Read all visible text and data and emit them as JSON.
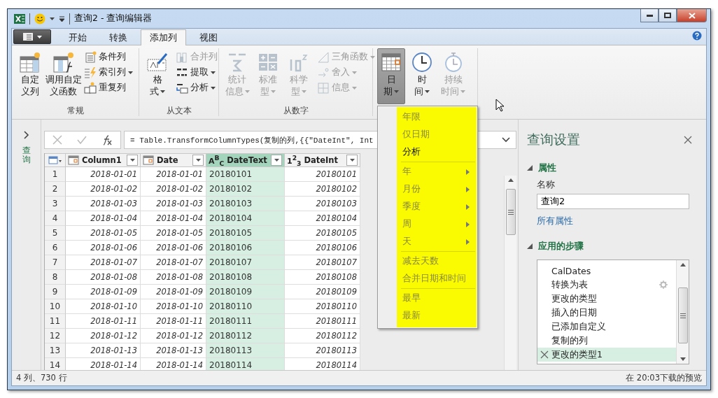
{
  "window": {
    "title": "查询2 - 查询编辑器"
  },
  "ribbon_tabs": [
    {
      "label": "开始",
      "selected": false
    },
    {
      "label": "转换",
      "selected": false
    },
    {
      "label": "添加列",
      "selected": true
    },
    {
      "label": "视图",
      "selected": false
    }
  ],
  "ribbon_groups": [
    {
      "label": "常规",
      "large_buttons": [
        {
          "lines": [
            "自定",
            "义列"
          ],
          "dropdown": false,
          "disabled": false,
          "pressed": false
        },
        {
          "lines": [
            "调用自定",
            "义函数"
          ],
          "dropdown": false,
          "disabled": false,
          "pressed": false
        }
      ],
      "small_buttons": [
        {
          "label": "条件列",
          "dropdown": false,
          "disabled": false
        },
        {
          "label": "索引列",
          "dropdown": true,
          "disabled": false
        },
        {
          "label": "重复列",
          "dropdown": false,
          "disabled": false
        }
      ]
    },
    {
      "label": "从文本",
      "large_buttons": [
        {
          "lines": [
            "格",
            "式"
          ],
          "dropdown": true,
          "disabled": false,
          "pressed": false
        }
      ],
      "small_buttons": [
        {
          "label": "合并列",
          "dropdown": false,
          "disabled": true
        },
        {
          "label": "提取",
          "dropdown": true,
          "disabled": false
        },
        {
          "label": "分析",
          "dropdown": true,
          "disabled": false
        }
      ]
    },
    {
      "label": "从数字",
      "large_buttons": [
        {
          "lines": [
            "统计",
            "信息"
          ],
          "dropdown": true,
          "disabled": true,
          "pressed": false
        },
        {
          "lines": [
            "标准",
            "型"
          ],
          "dropdown": true,
          "disabled": true,
          "pressed": false
        },
        {
          "lines": [
            "科学",
            "型"
          ],
          "dropdown": true,
          "disabled": true,
          "pressed": false
        }
      ],
      "small_buttons": [
        {
          "label": "三角函数",
          "dropdown": true,
          "disabled": true
        },
        {
          "label": "舍入",
          "dropdown": true,
          "disabled": true
        },
        {
          "label": "信息",
          "dropdown": true,
          "disabled": true
        }
      ]
    },
    {
      "large_buttons": [
        {
          "lines": [
            "日",
            "期"
          ],
          "dropdown": true,
          "disabled": false,
          "pressed": true
        },
        {
          "lines": [
            "时",
            "间"
          ],
          "dropdown": true,
          "disabled": false,
          "pressed": false
        },
        {
          "lines": [
            "持续",
            "时间"
          ],
          "dropdown": true,
          "disabled": true,
          "pressed": false
        }
      ]
    }
  ],
  "queries_pane": {
    "label": "查询"
  },
  "formula": {
    "text": "= Table.TransformColumnTypes(复制的列,{{\"DateInt\", Int"
  },
  "table": {
    "columns": [
      {
        "label": "Column1",
        "kind": "date",
        "selected": false
      },
      {
        "label": "Date",
        "kind": "date",
        "selected": false
      },
      {
        "label": "DateText",
        "kind": "text",
        "type_glyph": "A$^{B}$$_{C}$",
        "selected": true
      },
      {
        "label": "DateInt",
        "kind": "number",
        "type_glyph": "1$^{2}$$_{3}$",
        "selected": false
      }
    ],
    "rows": [
      {
        "number": "1",
        "cells": [
          "2018-01-01",
          "2018-01-01",
          "20180101",
          "20180101"
        ]
      },
      {
        "number": "2",
        "cells": [
          "2018-01-02",
          "2018-01-02",
          "20180102",
          "20180102"
        ]
      },
      {
        "number": "3",
        "cells": [
          "2018-01-03",
          "2018-01-03",
          "20180103",
          "20180103"
        ]
      },
      {
        "number": "4",
        "cells": [
          "2018-01-04",
          "2018-01-04",
          "20180104",
          "20180104"
        ]
      },
      {
        "number": "5",
        "cells": [
          "2018-01-05",
          "2018-01-05",
          "20180105",
          "20180105"
        ]
      },
      {
        "number": "6",
        "cells": [
          "2018-01-06",
          "2018-01-06",
          "20180106",
          "20180106"
        ]
      },
      {
        "number": "7",
        "cells": [
          "2018-01-07",
          "2018-01-07",
          "20180107",
          "20180107"
        ]
      },
      {
        "number": "8",
        "cells": [
          "2018-01-08",
          "2018-01-08",
          "20180108",
          "20180108"
        ]
      },
      {
        "number": "9",
        "cells": [
          "2018-01-09",
          "2018-01-09",
          "20180109",
          "20180109"
        ]
      },
      {
        "number": "10",
        "cells": [
          "2018-01-10",
          "2018-01-10",
          "20180110",
          "20180110"
        ]
      },
      {
        "number": "11",
        "cells": [
          "2018-01-11",
          "2018-01-11",
          "20180111",
          "20180111"
        ]
      },
      {
        "number": "12",
        "cells": [
          "2018-01-12",
          "2018-01-12",
          "20180112",
          "20180112"
        ]
      },
      {
        "number": "13",
        "cells": [
          "2018-01-13",
          "2018-01-13",
          "20180113",
          "20180113"
        ]
      },
      {
        "number": "14",
        "cells": [
          "2018-01-14",
          "2018-01-14",
          "20180114",
          "20180114"
        ]
      }
    ]
  },
  "date_menu": {
    "groups": [
      [
        {
          "label": "年限",
          "disabled": true,
          "submenu": false
        },
        {
          "label": "仅日期",
          "disabled": true,
          "submenu": false
        },
        {
          "label": "分析",
          "disabled": false,
          "submenu": false
        }
      ],
      [
        {
          "label": "年",
          "disabled": true,
          "submenu": true
        },
        {
          "label": "月份",
          "disabled": true,
          "submenu": true
        },
        {
          "label": "季度",
          "disabled": true,
          "submenu": true
        },
        {
          "label": "周",
          "disabled": true,
          "submenu": true
        },
        {
          "label": "天",
          "disabled": true,
          "submenu": true
        }
      ],
      [
        {
          "label": "减去天数",
          "disabled": true,
          "submenu": false
        },
        {
          "label": "合并日期和时间",
          "disabled": true,
          "submenu": false
        }
      ],
      [
        {
          "label": "最早",
          "disabled": true,
          "submenu": false
        },
        {
          "label": "最新",
          "disabled": true,
          "submenu": false
        }
      ]
    ]
  },
  "query_settings": {
    "title": "查询设置",
    "properties": {
      "heading": "属性",
      "expanded": true,
      "name_label": "名称",
      "name_value": "查询2",
      "all_properties_link": "所有属性"
    },
    "steps": {
      "heading": "应用的步骤",
      "expanded": true,
      "items": [
        {
          "label": "CalDates",
          "selected": false,
          "has_settings": false
        },
        {
          "label": "转换为表",
          "selected": false,
          "has_settings": true
        },
        {
          "label": "更改的类型",
          "selected": false,
          "has_settings": false
        },
        {
          "label": "插入的日期",
          "selected": false,
          "has_settings": false
        },
        {
          "label": "已添加自定义",
          "selected": false,
          "has_settings": false
        },
        {
          "label": "复制的列",
          "selected": false,
          "has_settings": false
        },
        {
          "label": "更改的类型1",
          "selected": true,
          "has_settings": false
        }
      ]
    }
  },
  "status_bar": {
    "left": "4 列、730 行",
    "right": "在 20:03下载的预览"
  }
}
